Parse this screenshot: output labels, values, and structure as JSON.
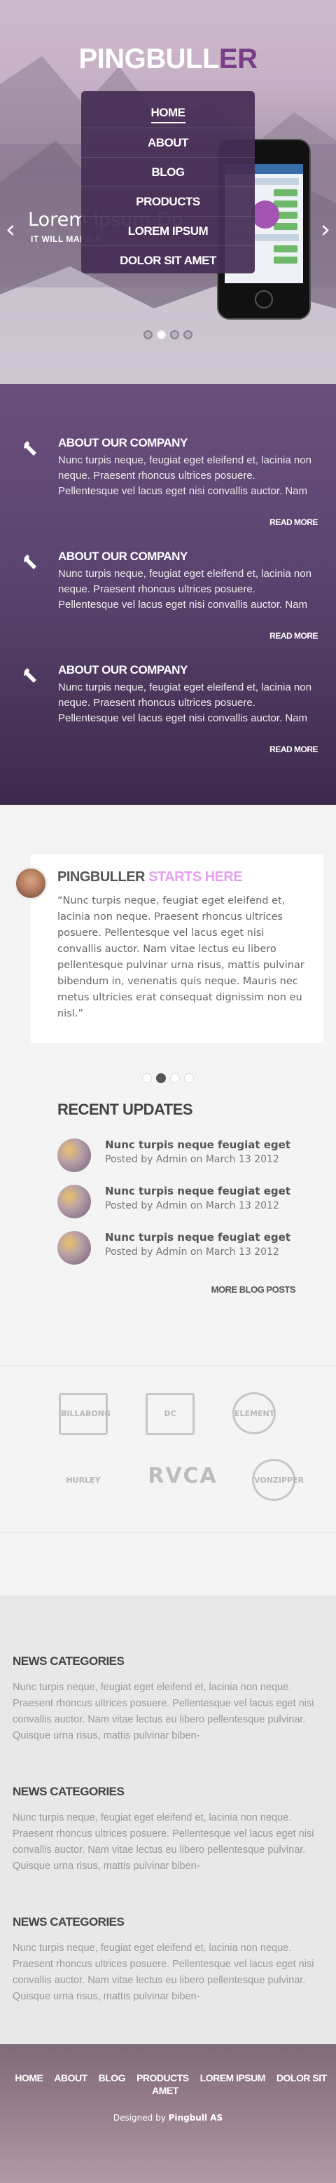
{
  "hero": {
    "logo_main": "PINGBULL",
    "logo_accent": "ER",
    "nav": [
      "HOME",
      "ABOUT",
      "BLOG",
      "PRODUCTS",
      "LOREM IPSUM",
      "DOLOR SIT AMET"
    ],
    "slide_title": "Lorem Ipsum Do",
    "slide_subtitle": "IT WILL MAKE A",
    "prev_arrow": "‹",
    "next_arrow": "›",
    "slide_count": 4,
    "active_slide": 1
  },
  "about": {
    "items": [
      {
        "title": "ABOUT OUR COMPANY",
        "text": "Nunc turpis neque, feugiat eget eleifend et, lacinia non neque. Praesent rhoncus ultrices posuere. Pellentesque vel lacus eget nisi convallis auctor. Nam",
        "more": "READ MORE"
      },
      {
        "title": "ABOUT OUR COMPANY",
        "text": "Nunc turpis neque, feugiat eget eleifend et, lacinia non neque. Praesent rhoncus ultrices posuere. Pellentesque vel lacus eget nisi convallis auctor. Nam",
        "more": "READ MORE"
      },
      {
        "title": "ABOUT OUR COMPANY",
        "text": "Nunc turpis neque, feugiat eget eleifend et, lacinia non neque. Praesent rhoncus ultrices posuere. Pellentesque vel lacus eget nisi convallis auctor. Nam",
        "more": "READ MORE"
      }
    ]
  },
  "testimonial": {
    "title_main": "PINGBULLER",
    "title_accent": "STARTS HERE",
    "quote": "“Nunc turpis neque, feugiat eget eleifend et, lacinia non neque. Praesent rhoncus ultrices posuere. Pellentesque vel lacus eget nisi convallis auctor. Nam vitae lectus eu libero pellentesque pulvinar urna risus, mattis pulvinar bibendum in, venenatis quis neque. Mauris nec metus ultricies erat consequat dignissim non eu nisl.”",
    "dot_count": 4,
    "active_dot": 1
  },
  "updates": {
    "heading": "RECENT UPDATES",
    "posts": [
      {
        "title": "Nunc turpis neque feugiat eget",
        "meta": "Posted by Admin on March 13 2012"
      },
      {
        "title": "Nunc turpis neque feugiat eget",
        "meta": "Posted by Admin on March 13 2012"
      },
      {
        "title": "Nunc turpis neque feugiat eget",
        "meta": "Posted by Admin on March 13 2012"
      }
    ],
    "more": "MORE BLOG POSTS"
  },
  "brands": {
    "row1": [
      "BILLABONG",
      "DC",
      "ELEMENT"
    ],
    "row2": [
      "HURLEY",
      "RVCA",
      "VONZIPPER"
    ]
  },
  "news": [
    {
      "title": "NEWS CATEGORIES",
      "text": "Nunc turpis neque, feugiat eget eleifend et, lacinia non neque. Praesent rhoncus ultrices posuere. Pellentesque vel lacus eget nisi convallis auctor. Nam vitae lectus eu libero pellentesque pulvinar. Quisque urna risus, mattis pulvinar biben-"
    },
    {
      "title": "NEWS CATEGORIES",
      "text": "Nunc turpis neque, feugiat eget eleifend et, lacinia non neque. Praesent rhoncus ultrices posuere. Pellentesque vel lacus eget nisi convallis auctor. Nam vitae lectus eu libero pellentesque pulvinar. Quisque urna risus, mattis pulvinar biben-"
    },
    {
      "title": "NEWS CATEGORIES",
      "text": "Nunc turpis neque, feugiat eget eleifend et, lacinia non neque. Praesent rhoncus ultrices posuere. Pellentesque vel lacus eget nisi convallis auctor. Nam vitae lectus eu libero pellentesque pulvinar. Quisque urna risus, mattis pulvinar biben-"
    }
  ],
  "footer": {
    "nav": [
      "HOME",
      "ABOUT",
      "BLOG",
      "PRODUCTS",
      "LOREM IPSUM",
      "DOLOR SIT AMET"
    ],
    "credit_prefix": "Designed by",
    "credit_name": "Pingbull AS"
  },
  "colors": {
    "accent": "#7a3e86",
    "accent_light": "#e5a1ef",
    "purple": "#5b4470"
  }
}
